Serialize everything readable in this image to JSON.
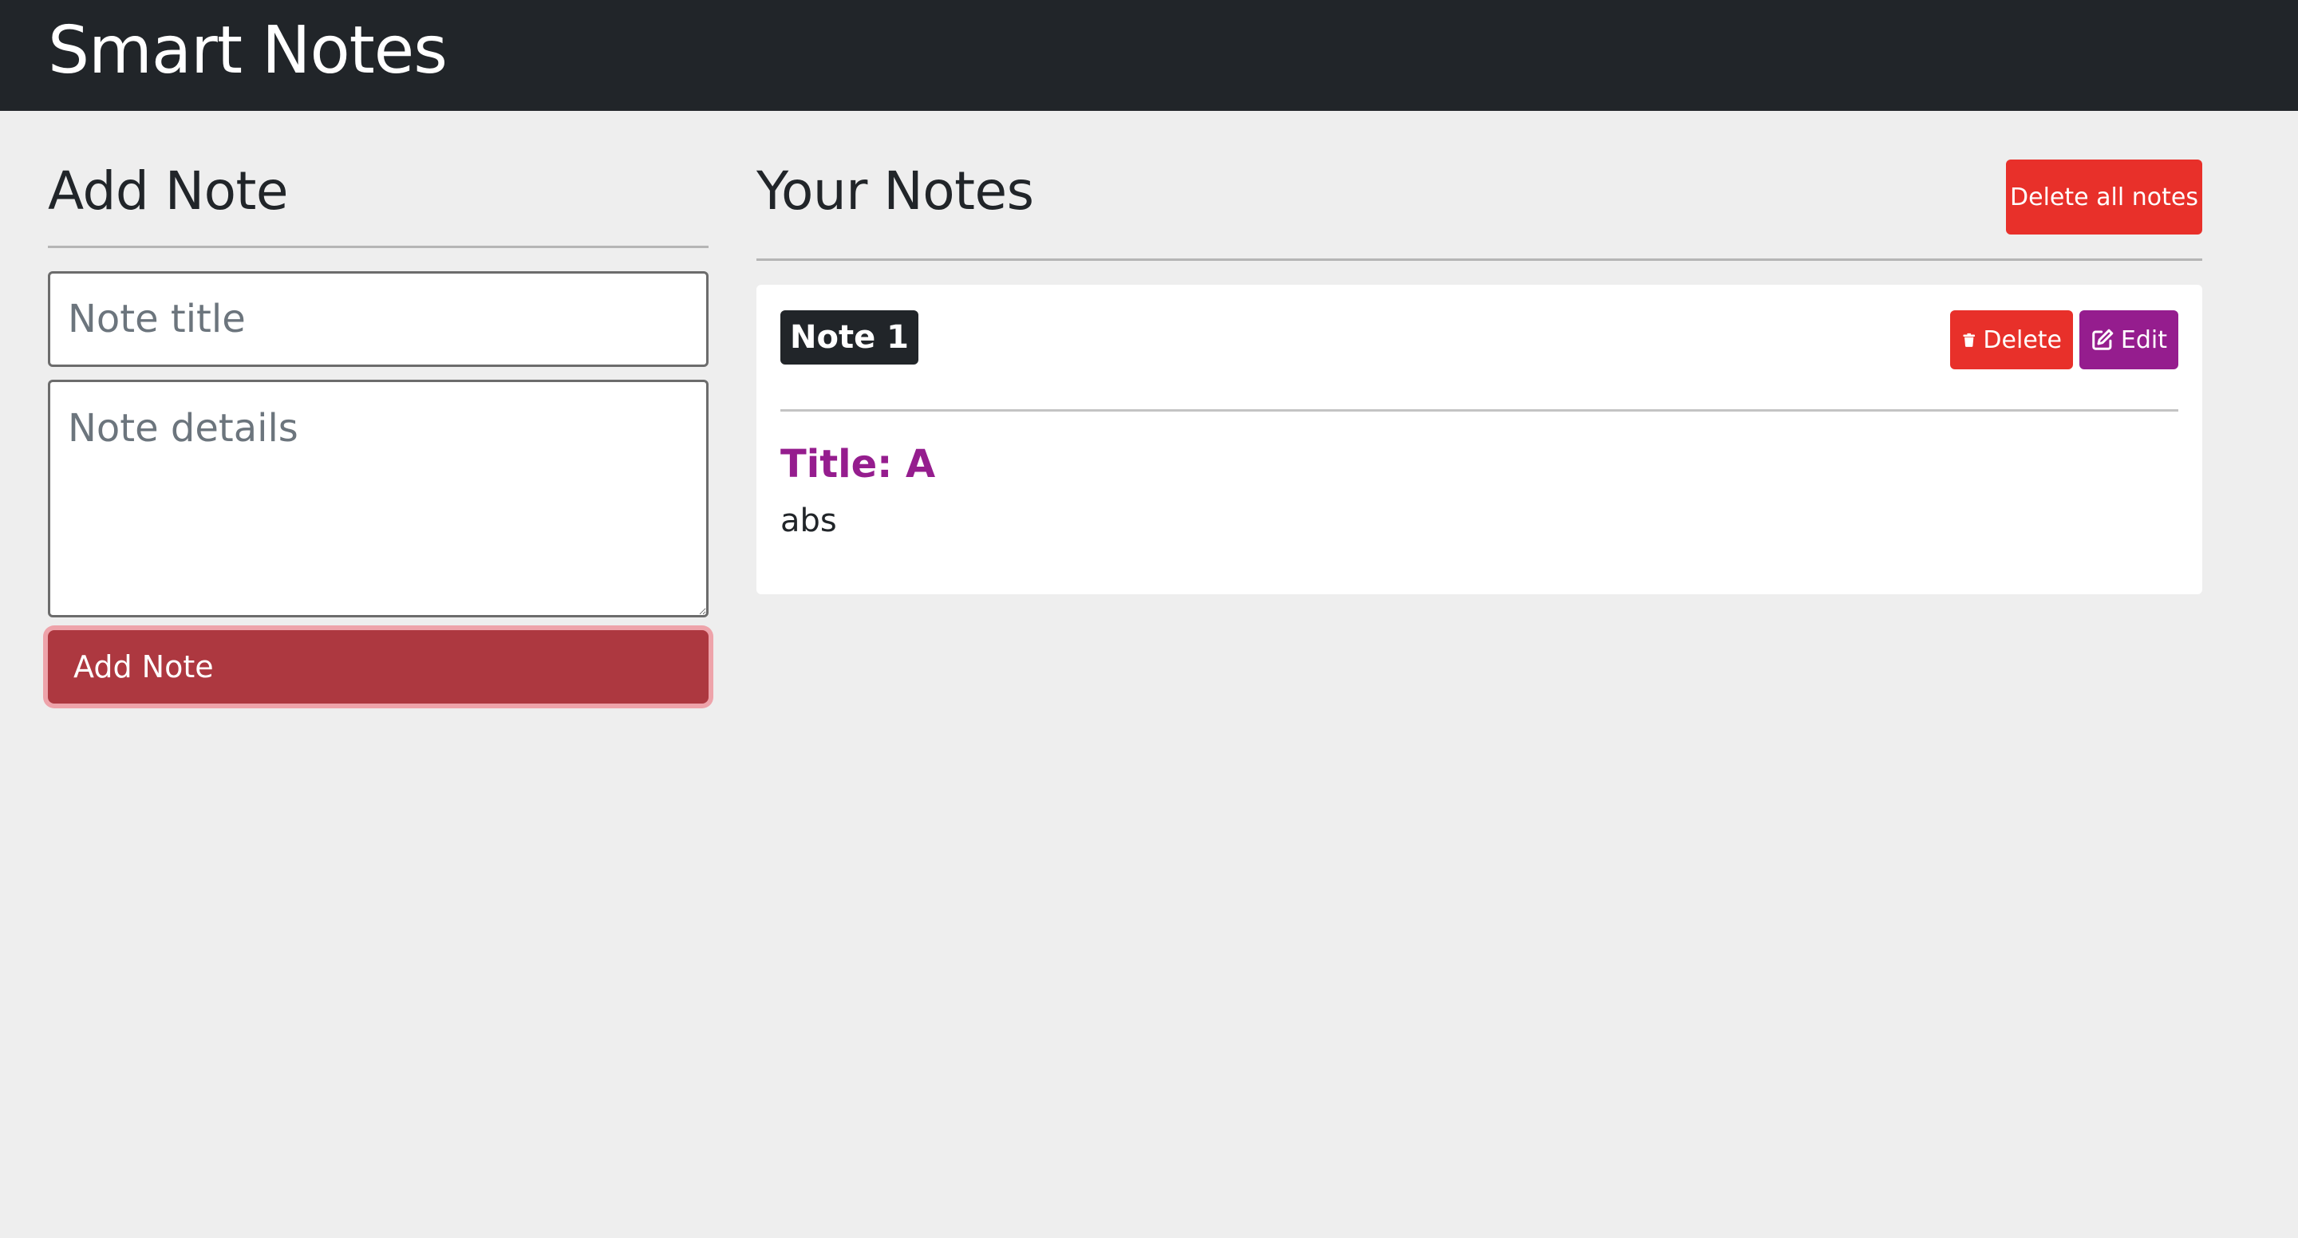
{
  "app": {
    "title": "Smart Notes"
  },
  "add_note": {
    "heading": "Add Note",
    "title_placeholder": "Note title",
    "details_placeholder": "Note details",
    "submit_label": "Add Note"
  },
  "notes_panel": {
    "heading": "Your Notes",
    "delete_all_label": "Delete all notes",
    "notes": [
      {
        "badge": "Note 1",
        "title": "Title: A",
        "body": "abs",
        "delete_label": "Delete",
        "edit_label": "Edit"
      }
    ]
  },
  "colors": {
    "navbar": "#212529",
    "background": "#eeeeee",
    "add_button": "#ad3840",
    "danger": "#e8302a",
    "edit": "#951d8e"
  },
  "icons": {
    "delete": "trash-icon",
    "edit": "edit-icon"
  }
}
